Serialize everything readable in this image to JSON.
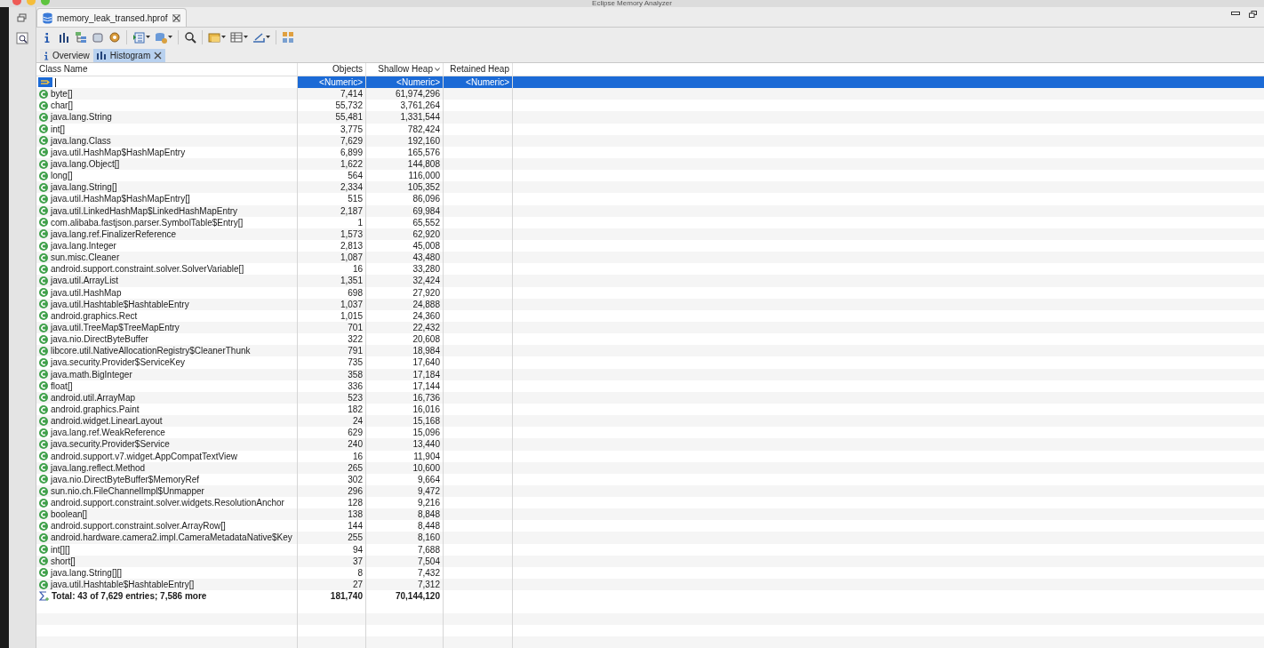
{
  "window": {
    "title": "Eclipse Memory Analyzer"
  },
  "editor_tab": {
    "label": "memory_leak_transed.hprof"
  },
  "tabs": [
    {
      "label": "Overview",
      "selected": false
    },
    {
      "label": "Histogram",
      "selected": true
    }
  ],
  "table": {
    "columns": [
      {
        "label": "Class Name",
        "sorted": false
      },
      {
        "label": "Objects",
        "sorted": false
      },
      {
        "label": "Shallow Heap",
        "sorted": true
      },
      {
        "label": "Retained Heap",
        "sorted": false
      }
    ],
    "filter_row": {
      "selected": true,
      "cells": [
        "<Numeric>",
        "<Numeric>",
        "<Numeric>"
      ]
    },
    "rows": [
      {
        "name": "byte[]",
        "objects": "7,414",
        "shallow_heap": "61,974,296"
      },
      {
        "name": "char[]",
        "objects": "55,732",
        "shallow_heap": "3,761,264"
      },
      {
        "name": "java.lang.String",
        "objects": "55,481",
        "shallow_heap": "1,331,544"
      },
      {
        "name": "int[]",
        "objects": "3,775",
        "shallow_heap": "782,424"
      },
      {
        "name": "java.lang.Class",
        "objects": "7,629",
        "shallow_heap": "192,160"
      },
      {
        "name": "java.util.HashMap$HashMapEntry",
        "objects": "6,899",
        "shallow_heap": "165,576"
      },
      {
        "name": "java.lang.Object[]",
        "objects": "1,622",
        "shallow_heap": "144,808"
      },
      {
        "name": "long[]",
        "objects": "564",
        "shallow_heap": "116,000"
      },
      {
        "name": "java.lang.String[]",
        "objects": "2,334",
        "shallow_heap": "105,352"
      },
      {
        "name": "java.util.HashMap$HashMapEntry[]",
        "objects": "515",
        "shallow_heap": "86,096"
      },
      {
        "name": "java.util.LinkedHashMap$LinkedHashMapEntry",
        "objects": "2,187",
        "shallow_heap": "69,984"
      },
      {
        "name": "com.alibaba.fastjson.parser.SymbolTable$Entry[]",
        "objects": "1",
        "shallow_heap": "65,552"
      },
      {
        "name": "java.lang.ref.FinalizerReference",
        "objects": "1,573",
        "shallow_heap": "62,920"
      },
      {
        "name": "java.lang.Integer",
        "objects": "2,813",
        "shallow_heap": "45,008"
      },
      {
        "name": "sun.misc.Cleaner",
        "objects": "1,087",
        "shallow_heap": "43,480"
      },
      {
        "name": "android.support.constraint.solver.SolverVariable[]",
        "objects": "16",
        "shallow_heap": "33,280"
      },
      {
        "name": "java.util.ArrayList",
        "objects": "1,351",
        "shallow_heap": "32,424"
      },
      {
        "name": "java.util.HashMap",
        "objects": "698",
        "shallow_heap": "27,920"
      },
      {
        "name": "java.util.Hashtable$HashtableEntry",
        "objects": "1,037",
        "shallow_heap": "24,888"
      },
      {
        "name": "android.graphics.Rect",
        "objects": "1,015",
        "shallow_heap": "24,360"
      },
      {
        "name": "java.util.TreeMap$TreeMapEntry",
        "objects": "701",
        "shallow_heap": "22,432"
      },
      {
        "name": "java.nio.DirectByteBuffer",
        "objects": "322",
        "shallow_heap": "20,608"
      },
      {
        "name": "libcore.util.NativeAllocationRegistry$CleanerThunk",
        "objects": "791",
        "shallow_heap": "18,984"
      },
      {
        "name": "java.security.Provider$ServiceKey",
        "objects": "735",
        "shallow_heap": "17,640"
      },
      {
        "name": "java.math.BigInteger",
        "objects": "358",
        "shallow_heap": "17,184"
      },
      {
        "name": "float[]",
        "objects": "336",
        "shallow_heap": "17,144"
      },
      {
        "name": "android.util.ArrayMap",
        "objects": "523",
        "shallow_heap": "16,736"
      },
      {
        "name": "android.graphics.Paint",
        "objects": "182",
        "shallow_heap": "16,016"
      },
      {
        "name": "android.widget.LinearLayout",
        "objects": "24",
        "shallow_heap": "15,168"
      },
      {
        "name": "java.lang.ref.WeakReference",
        "objects": "629",
        "shallow_heap": "15,096"
      },
      {
        "name": "java.security.Provider$Service",
        "objects": "240",
        "shallow_heap": "13,440"
      },
      {
        "name": "android.support.v7.widget.AppCompatTextView",
        "objects": "16",
        "shallow_heap": "11,904"
      },
      {
        "name": "java.lang.reflect.Method",
        "objects": "265",
        "shallow_heap": "10,600"
      },
      {
        "name": "java.nio.DirectByteBuffer$MemoryRef",
        "objects": "302",
        "shallow_heap": "9,664"
      },
      {
        "name": "sun.nio.ch.FileChannelImpl$Unmapper",
        "objects": "296",
        "shallow_heap": "9,472"
      },
      {
        "name": "android.support.constraint.solver.widgets.ResolutionAnchor",
        "objects": "128",
        "shallow_heap": "9,216"
      },
      {
        "name": "boolean[]",
        "objects": "138",
        "shallow_heap": "8,848"
      },
      {
        "name": "android.support.constraint.solver.ArrayRow[]",
        "objects": "144",
        "shallow_heap": "8,448"
      },
      {
        "name": "android.hardware.camera2.impl.CameraMetadataNative$Key",
        "objects": "255",
        "shallow_heap": "8,160"
      },
      {
        "name": "int[][]",
        "objects": "94",
        "shallow_heap": "7,688"
      },
      {
        "name": "short[]",
        "objects": "37",
        "shallow_heap": "7,504"
      },
      {
        "name": "java.lang.String[][]",
        "objects": "8",
        "shallow_heap": "7,432"
      },
      {
        "name": "java.util.Hashtable$HashtableEntry[]",
        "objects": "27",
        "shallow_heap": "7,312"
      }
    ],
    "total": {
      "label": "Total: 43 of 7,629 entries; 7,586 more",
      "objects": "181,740",
      "shallow_heap": "70,144,120"
    }
  }
}
